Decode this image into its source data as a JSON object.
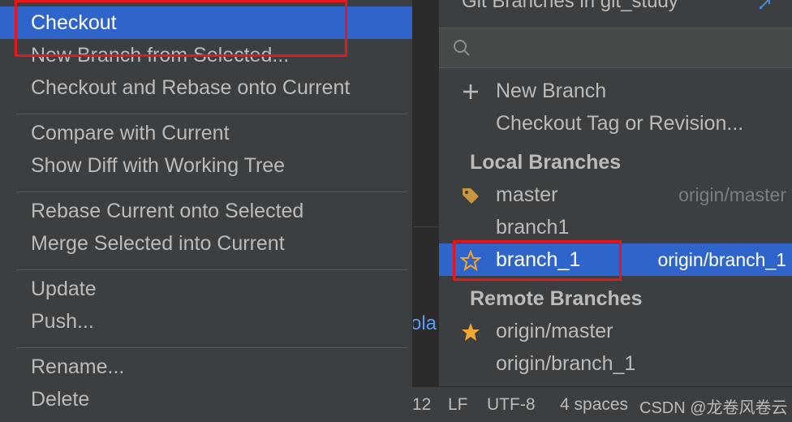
{
  "context_menu": {
    "items": [
      {
        "label": "Checkout",
        "selected": true
      },
      {
        "label": "New Branch from Selected..."
      },
      {
        "label": "Checkout and Rebase onto Current"
      },
      {
        "label": "Compare with Current"
      },
      {
        "label": "Show Diff with Working Tree"
      },
      {
        "label": "Rebase Current onto Selected"
      },
      {
        "label": "Merge Selected into Current"
      },
      {
        "label": "Update"
      },
      {
        "label": "Push..."
      },
      {
        "label": "Rename..."
      },
      {
        "label": "Delete"
      }
    ]
  },
  "branches_popup": {
    "title": "Git Branches in git_study",
    "search_placeholder": "",
    "actions": [
      {
        "label": "New Branch",
        "icon": "plus-icon"
      },
      {
        "label": "Checkout Tag or Revision...",
        "icon": ""
      }
    ],
    "local_header": "Local Branches",
    "local": [
      {
        "name": "master",
        "tracking": "origin/master",
        "icon": "tag-icon"
      },
      {
        "name": "branch1",
        "tracking": "",
        "icon": ""
      },
      {
        "name": "branch_1",
        "tracking": "origin/branch_1",
        "icon": "star-outline-icon",
        "selected": true
      }
    ],
    "remote_header": "Remote Branches",
    "remote": [
      {
        "name": "origin/master",
        "icon": "star-filled-icon"
      },
      {
        "name": "origin/branch_1",
        "icon": ""
      }
    ]
  },
  "editor": {
    "code_fragment": "ola"
  },
  "statusbar": {
    "line": "12",
    "line_separator": "LF",
    "encoding": "UTF-8",
    "indent": "4 spaces"
  },
  "watermark": "CSDN @龙卷风卷云",
  "colors": {
    "selection": "#2f65ca",
    "annotation": "#e8161b",
    "tag": "#c9953f",
    "star": "#f0a732"
  }
}
